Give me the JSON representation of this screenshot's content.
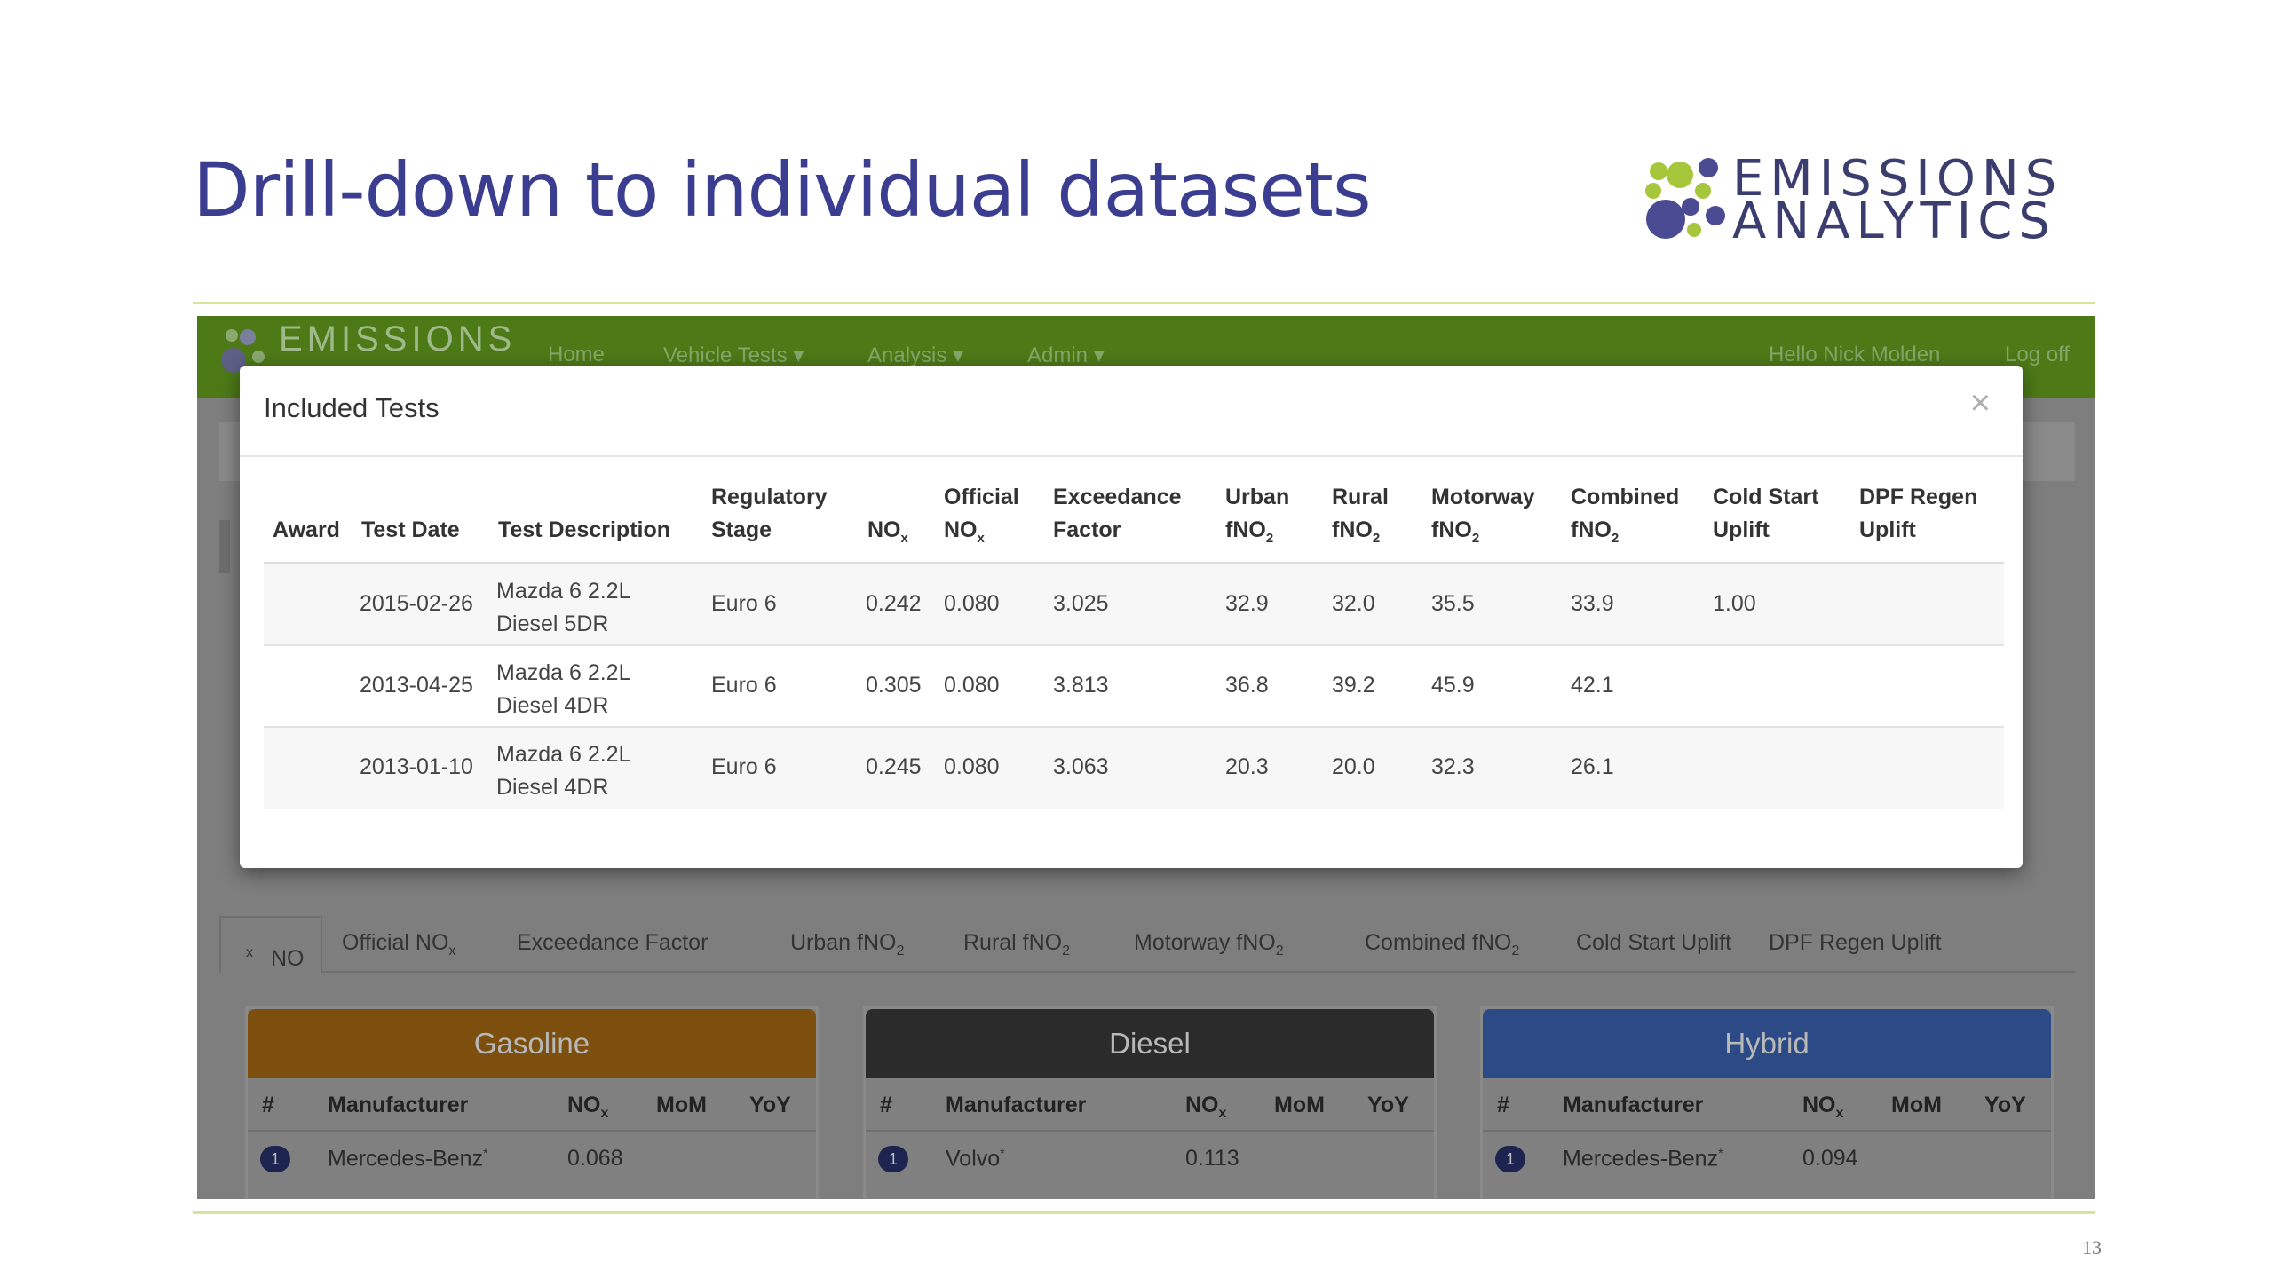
{
  "slide": {
    "title": "Drill-down to individual datasets",
    "logo_line1": "EMISSIONS",
    "logo_line2": "ANALYTICS",
    "page_number": "13"
  },
  "navbar": {
    "logo_text": "EMISSIONS",
    "items": [
      "Home",
      "Vehicle Tests",
      "Analysis",
      "Admin"
    ],
    "greeting": "Hello Nick Molden",
    "logoff": "Log off"
  },
  "modal": {
    "title": "Included Tests",
    "close": "×",
    "headers": {
      "award": "Award",
      "test_date": "Test Date",
      "test_description": "Test Description",
      "regulatory_stage_1": "Regulatory",
      "regulatory_stage_2": "Stage",
      "nox": "NO",
      "official_1": "Official",
      "official_2": "NO",
      "exceedance_1": "Exceedance",
      "exceedance_2": "Factor",
      "urban_1": "Urban",
      "urban_2": "fNO",
      "rural_1": "Rural",
      "rural_2": "fNO",
      "motorway_1": "Motorway",
      "motorway_2": "fNO",
      "combined_1": "Combined",
      "combined_2": "fNO",
      "coldstart_1": "Cold Start",
      "coldstart_2": "Uplift",
      "dpf_1": "DPF Regen",
      "dpf_2": "Uplift",
      "sub_x": "x",
      "sub_2": "2"
    },
    "rows": [
      {
        "award": "",
        "test_date": "2015-02-26",
        "desc_1": "Mazda 6 2.2L",
        "desc_2": "Diesel 5DR",
        "stage": "Euro 6",
        "nox": "0.242",
        "official": "0.080",
        "exceedance": "3.025",
        "urban": "32.9",
        "rural": "32.0",
        "motorway": "35.5",
        "combined": "33.9",
        "cold_start": "1.00",
        "dpf": ""
      },
      {
        "award": "",
        "test_date": "2013-04-25",
        "desc_1": "Mazda 6 2.2L",
        "desc_2": "Diesel 4DR",
        "stage": "Euro 6",
        "nox": "0.305",
        "official": "0.080",
        "exceedance": "3.813",
        "urban": "36.8",
        "rural": "39.2",
        "motorway": "45.9",
        "combined": "42.1",
        "cold_start": "",
        "dpf": ""
      },
      {
        "award": "",
        "test_date": "2013-01-10",
        "desc_1": "Mazda 6 2.2L",
        "desc_2": "Diesel 4DR",
        "stage": "Euro 6",
        "nox": "0.245",
        "official": "0.080",
        "exceedance": "3.063",
        "urban": "20.3",
        "rural": "20.0",
        "motorway": "32.3",
        "combined": "26.1",
        "cold_start": "",
        "dpf": ""
      }
    ]
  },
  "tabs": {
    "nox": "NO",
    "official_nox": "Official NO",
    "exceedance": "Exceedance Factor",
    "urban": "Urban fNO",
    "rural": "Rural fNO",
    "motorway": "Motorway fNO",
    "combined": "Combined fNO",
    "cold_start": "Cold Start Uplift",
    "dpf": "DPF Regen Uplift",
    "sub_x": "x",
    "sub_2": "2"
  },
  "panels": [
    {
      "title": "Gasoline",
      "color": "#7c4f0f",
      "col_num": "#",
      "col_manufacturer": "Manufacturer",
      "col_nox": "NO",
      "col_mom": "MoM",
      "col_yoy": "YoY",
      "sub_x": "x",
      "rank": "1",
      "manufacturer": "Mercedes-Benz",
      "mark": "*",
      "value": "0.068"
    },
    {
      "title": "Diesel",
      "color": "#2b2b2b",
      "col_num": "#",
      "col_manufacturer": "Manufacturer",
      "col_nox": "NO",
      "col_mom": "MoM",
      "col_yoy": "YoY",
      "sub_x": "x",
      "rank": "1",
      "manufacturer": "Volvo",
      "mark": "*",
      "value": "0.113"
    },
    {
      "title": "Hybrid",
      "color": "#2b4a86",
      "col_num": "#",
      "col_manufacturer": "Manufacturer",
      "col_nox": "NO",
      "col_mom": "MoM",
      "col_yoy": "YoY",
      "sub_x": "x",
      "rank": "1",
      "manufacturer": "Mercedes-Benz",
      "mark": "*",
      "value": "0.094"
    }
  ],
  "colors": {
    "title_purple": "#3b3d91",
    "rule_green": "#d6e59a",
    "navbar_green": "#4d7a17"
  }
}
